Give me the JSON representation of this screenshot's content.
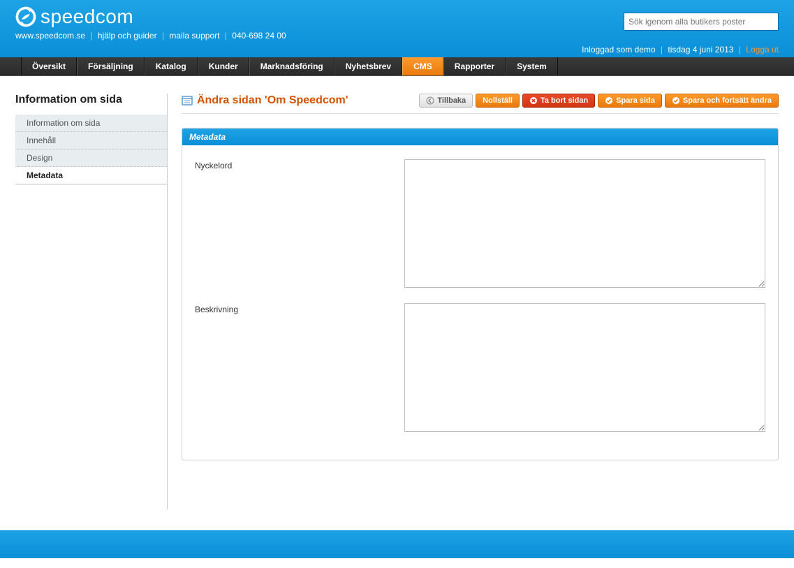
{
  "header": {
    "brand": "speedcom",
    "links": {
      "site": "www.speedcom.se",
      "help": "hjälp och guider",
      "mail": "maila support",
      "phone": "040-698 24 00"
    },
    "search_placeholder": "Sök igenom alla butikers poster",
    "status": {
      "logged_in": "Inloggad som demo",
      "date": "tisdag 4 juni 2013",
      "logout": "Logga ut"
    }
  },
  "nav": {
    "items": [
      {
        "label": "Översikt"
      },
      {
        "label": "Försäljning"
      },
      {
        "label": "Katalog"
      },
      {
        "label": "Kunder"
      },
      {
        "label": "Marknadsföring"
      },
      {
        "label": "Nyhetsbrev"
      },
      {
        "label": "CMS"
      },
      {
        "label": "Rapporter"
      },
      {
        "label": "System"
      }
    ],
    "active": "CMS"
  },
  "sidebar": {
    "title": "Information om sida",
    "items": [
      {
        "label": "Information om sida"
      },
      {
        "label": "Innehåll"
      },
      {
        "label": "Design"
      },
      {
        "label": "Metadata"
      }
    ],
    "active": "Metadata"
  },
  "main": {
    "title": "Ändra sidan 'Om Speedcom'",
    "buttons": {
      "back": "Tillbaka",
      "reset": "Nollställ",
      "delete": "Ta bort sidan",
      "save": "Spara sida",
      "save_continue": "Spara och fortsätt ändra"
    },
    "panel": {
      "head": "Metadata",
      "fields": {
        "keywords_label": "Nyckelord",
        "keywords_value": "",
        "description_label": "Beskrivning",
        "description_value": ""
      }
    }
  }
}
